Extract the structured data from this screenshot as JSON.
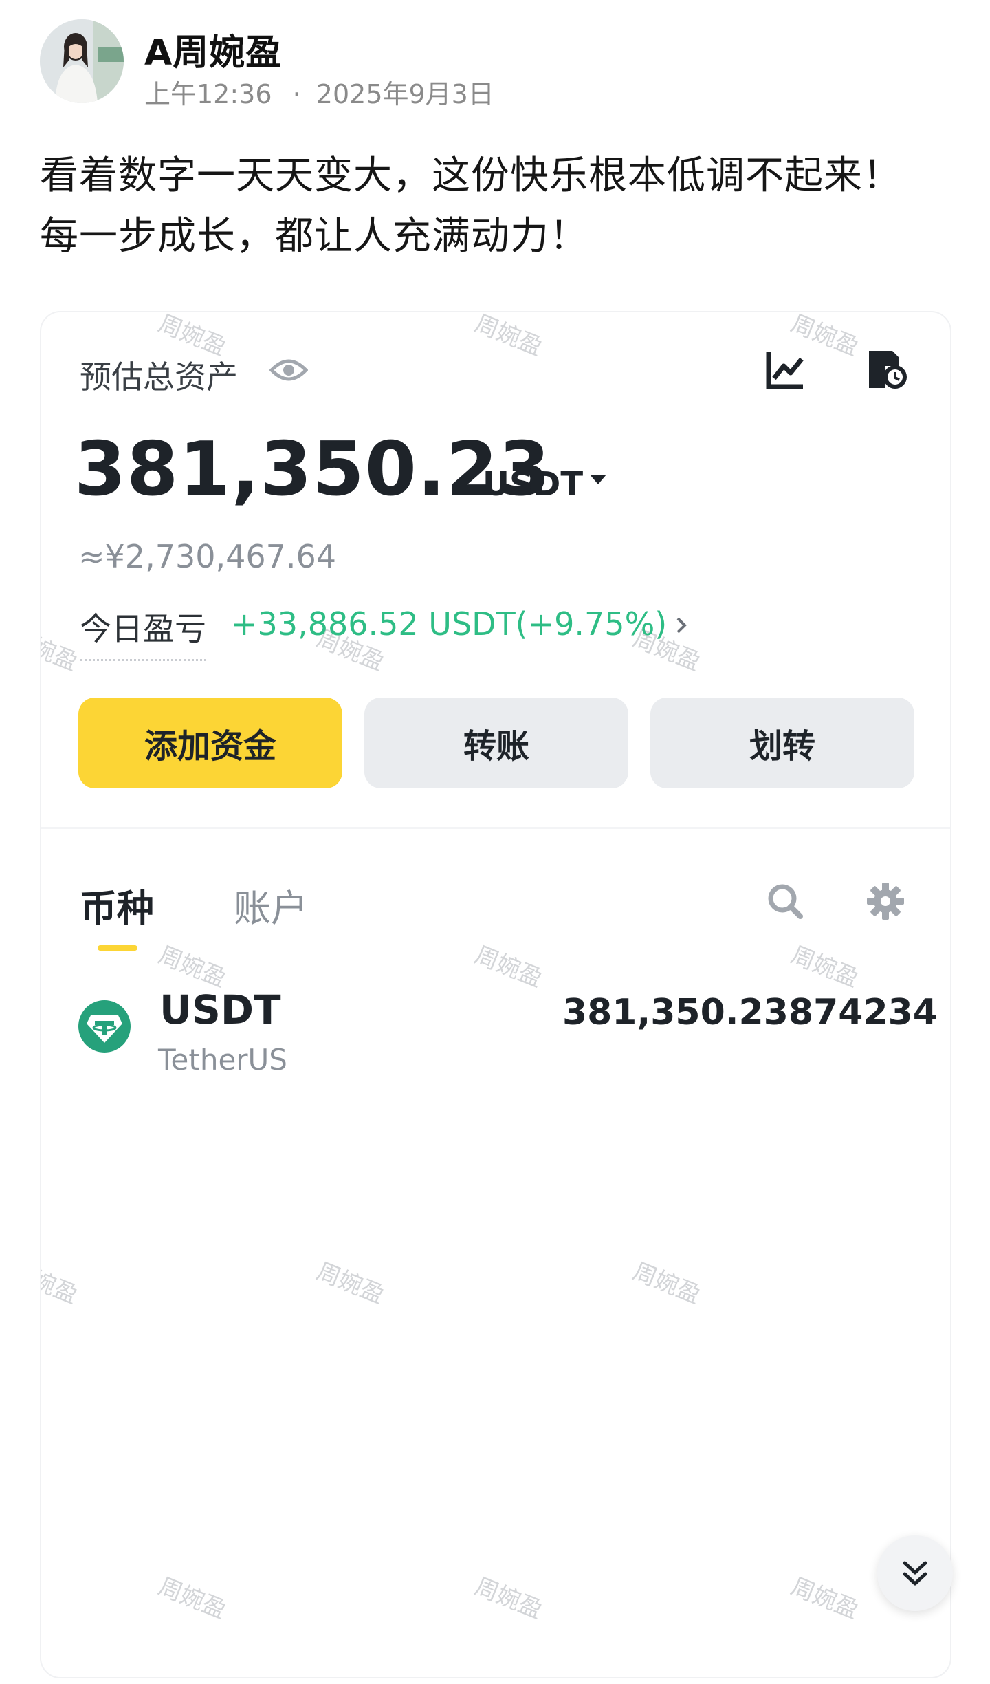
{
  "post": {
    "author": "A周婉盈",
    "time": "上午12:36",
    "separator": "·",
    "date": "2025年9月3日",
    "text_line1": "看着数字一天天变大，这份快乐根本低调不起来！",
    "text_line2": "每一步成长，都让人充满动力！"
  },
  "wallet": {
    "asset_label": "预估总资产",
    "balance": "381,350.23",
    "unit": "USDT",
    "cny_equivalent": "≈¥2,730,467.64",
    "pnl_label": "今日盈亏",
    "pnl_value": "+33,886.52 USDT(+9.75%)",
    "actions": {
      "add_funds": "添加资金",
      "transfer": "转账",
      "internal_transfer": "划转"
    },
    "tabs": {
      "coins": "币种",
      "accounts": "账户"
    },
    "coins": [
      {
        "symbol": "USDT",
        "name": "TetherUS",
        "amount": "381,350.23874234"
      }
    ],
    "watermark": "周婉盈"
  },
  "colors": {
    "brand_yellow": "#fcd535",
    "profit_green": "#2ebd85",
    "tether_teal": "#26a17b",
    "text_primary": "#1e2329",
    "text_secondary": "#8a9098"
  },
  "icons": [
    "eye-icon",
    "chart-icon",
    "history-icon",
    "chevron-right-icon",
    "search-icon",
    "gear-icon",
    "tether-icon",
    "double-chevron-down-icon"
  ]
}
